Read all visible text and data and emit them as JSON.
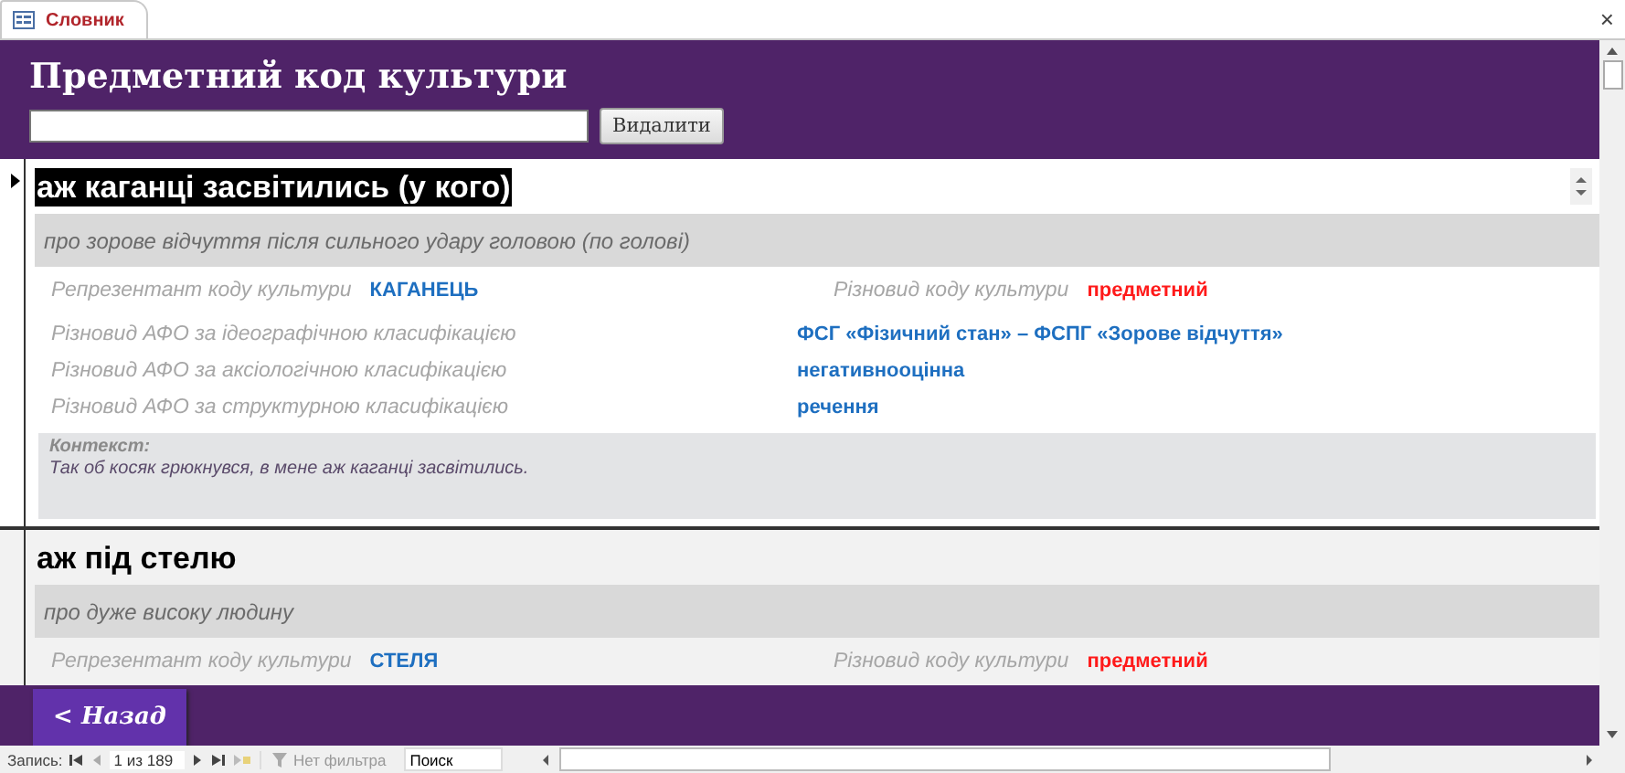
{
  "tab": {
    "label": "Словник",
    "close": "×"
  },
  "header": {
    "title": "Предметний код культури",
    "delete_button": "Видалити"
  },
  "records": [
    {
      "current": true,
      "title": "аж каганці засвітились (у кого)",
      "title_highlighted": true,
      "description": "про зорове відчуття після сильного удару головою (по голові)",
      "representative": {
        "label": "Репрезентант коду культури",
        "value": "КАГАНЕЦЬ"
      },
      "code_type": {
        "label": "Різновид коду культури",
        "value": "предметний"
      },
      "classifications": [
        {
          "label": "Різновид АФО за ідеографічною класифікацією",
          "value": "ФСГ «Фізичний стан» – ФСПГ «Зорове відчуття»"
        },
        {
          "label": "Різновид АФО за аксіологічною класифікацією",
          "value": "негативнооцінна"
        },
        {
          "label": "Різновид АФО за структурною класифікацією",
          "value": "речення"
        }
      ],
      "context": {
        "label": "Контекст:",
        "text": "Так об косяк грюкнувся, в мене аж каганці засвітились."
      }
    },
    {
      "current": false,
      "title": "аж під стелю",
      "title_highlighted": false,
      "description": "про дуже високу людину",
      "representative": {
        "label": "Репрезентант коду культури",
        "value": "СТЕЛЯ"
      },
      "code_type": {
        "label": "Різновид коду культури",
        "value": "предметний"
      }
    }
  ],
  "back_button": "< Назад",
  "navigation": {
    "label": "Запись:",
    "position": "1 из 189",
    "filter": "Нет фильтра",
    "search_placeholder": "Поиск"
  }
}
